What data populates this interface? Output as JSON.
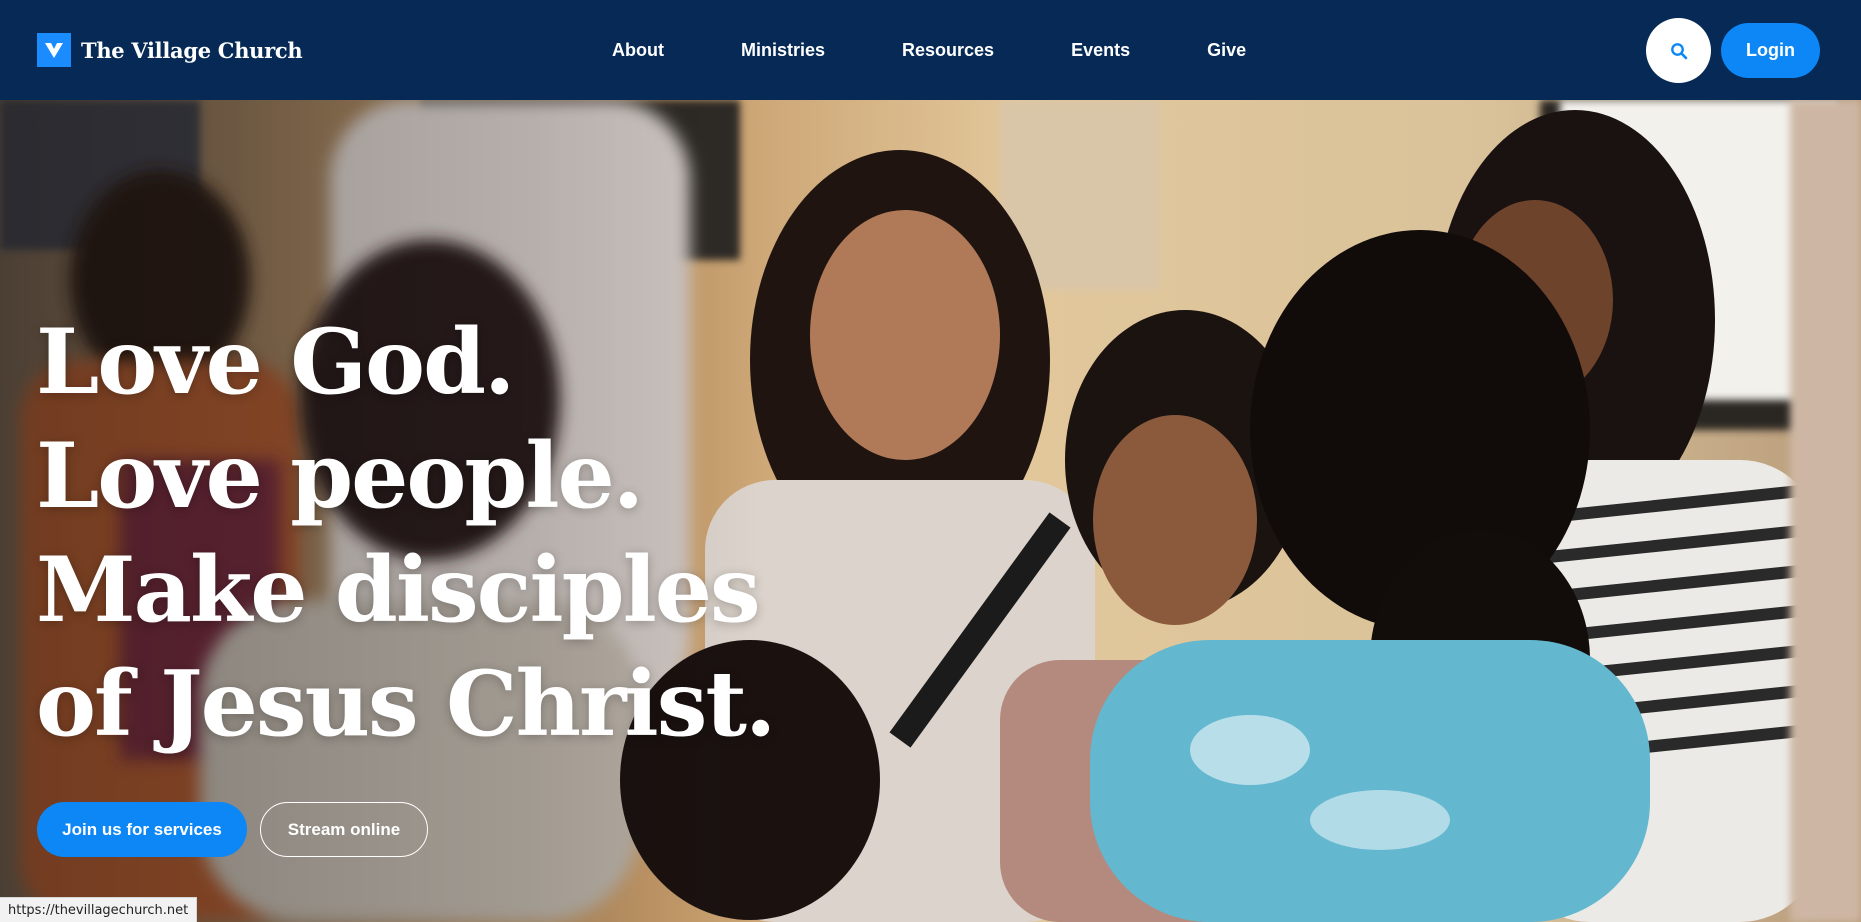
{
  "header": {
    "brand_name": "The Village Church",
    "nav": [
      "About",
      "Ministries",
      "Resources",
      "Events",
      "Give"
    ],
    "login_label": "Login",
    "icons": {
      "logo": "village-v-logo",
      "search": "search-icon"
    }
  },
  "hero": {
    "headline_lines": [
      "Love God.",
      "Love people.",
      "Make disciples",
      "of Jesus Christ."
    ],
    "primary_cta": "Join us for services",
    "secondary_cta": "Stream online"
  },
  "status_bar": {
    "url": "https://thevillagechurch.net"
  },
  "colors": {
    "header_bg": "#062a55",
    "accent": "#0d87f5",
    "text_on_dark": "#ffffff"
  }
}
